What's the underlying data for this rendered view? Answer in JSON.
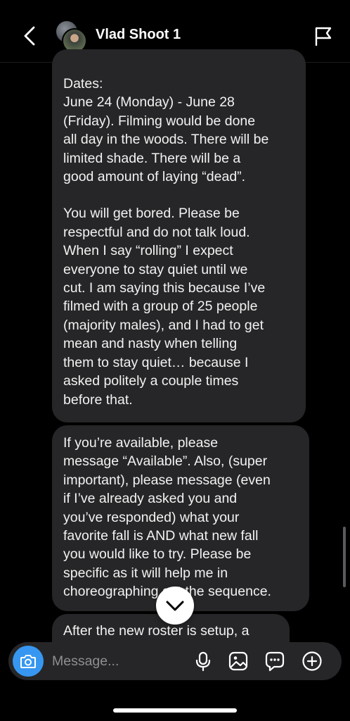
{
  "header": {
    "title": "Vlad Shoot 1"
  },
  "messages": [
    {
      "paragraphs": [
        [
          "Dates:",
          "June 24 (Monday) - June 28",
          "(Friday). Filming would be done",
          "all day in the woods. There will be",
          "limited shade. There will be a",
          "good amount of laying “dead”."
        ],
        [
          "You will get bored. Please be",
          "respectful and do not talk loud.",
          "When I say “rolling” I expect",
          "everyone to stay quiet until we",
          "cut. I am saying this because I’ve",
          "filmed with a group of 25 people",
          "(majority males), and I had to get",
          "mean and nasty when telling",
          "them to stay quiet… because I",
          "asked politely a couple times",
          "before that."
        ]
      ]
    },
    {
      "paragraphs": [
        [
          "If you’re available, please",
          "message “Available”. Also, (super",
          "important), please message (even",
          "if I’ve already asked you and",
          "you’ve responded) what your",
          "favorite fall is AND what new fall",
          "you would like to try. Please be",
          "specific as it will help me in",
          "choreographing out the sequence."
        ]
      ]
    },
    {
      "paragraphs": [
        [
          "After the new roster is setup, a"
        ]
      ]
    }
  ],
  "composer": {
    "placeholder": "Message..."
  },
  "icons": {
    "back": "chevron-left-icon",
    "report": "flag-icon",
    "scroll_down": "chevron-down-icon",
    "camera": "camera-icon",
    "mic": "microphone-icon",
    "gallery": "image-icon",
    "sticker": "chat-bubble-icon",
    "more": "plus-circle-icon"
  },
  "colors": {
    "background": "#000000",
    "bubble": "#262628",
    "accent": "#3797f0",
    "placeholder": "#8e8e93"
  }
}
